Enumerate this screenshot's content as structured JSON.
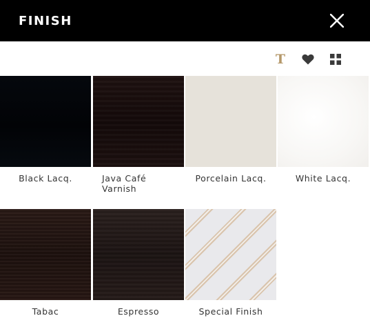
{
  "header": {
    "title": "FINISH"
  },
  "toolbar": {
    "icons": [
      "text-icon",
      "heart-icon",
      "grid-icon"
    ],
    "text_glyph": "T",
    "accent_color": "#b5986a",
    "icon_color": "#3a3a3a"
  },
  "finishes": [
    {
      "label": "Black Lacq."
    },
    {
      "label": "Java Café\nVarnish"
    },
    {
      "label": "Porcelain Lacq."
    },
    {
      "label": "White Lacq."
    },
    {
      "label": "Tabac"
    },
    {
      "label": "Espresso"
    },
    {
      "label": "Special Finish"
    }
  ],
  "colors": {
    "header_bg": "#000000",
    "label_text": "#333333"
  }
}
